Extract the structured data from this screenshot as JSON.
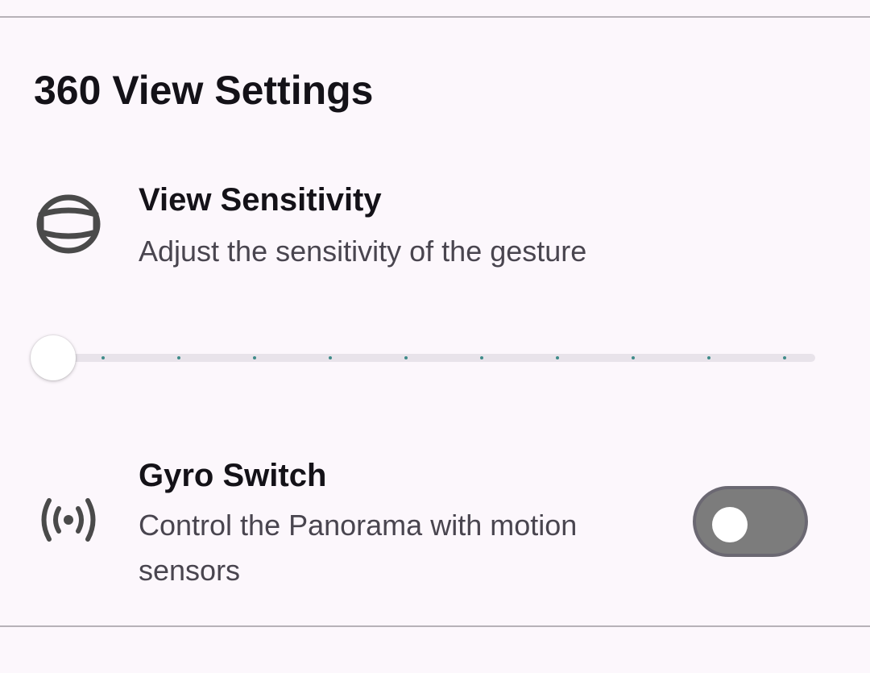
{
  "section": {
    "title": "360 View Settings"
  },
  "view_sensitivity": {
    "icon": "panorama-sphere-icon",
    "title": "View Sensitivity",
    "subtitle": "Adjust the sensitivity of the gesture",
    "slider": {
      "value_fraction": 0,
      "tick_count": 10
    }
  },
  "gyro_switch": {
    "icon": "sensor-signal-icon",
    "title": "Gyro Switch",
    "subtitle": "Control the Panorama with motion sensors",
    "enabled": false
  },
  "colors": {
    "background": "#fcf7fc",
    "divider": "#b7b2b8",
    "slider_track": "#e8e3ea",
    "slider_tick": "#3f8b8a",
    "toggle_track_off": "#7c7c7c",
    "toggle_outline": "#6b6872"
  }
}
